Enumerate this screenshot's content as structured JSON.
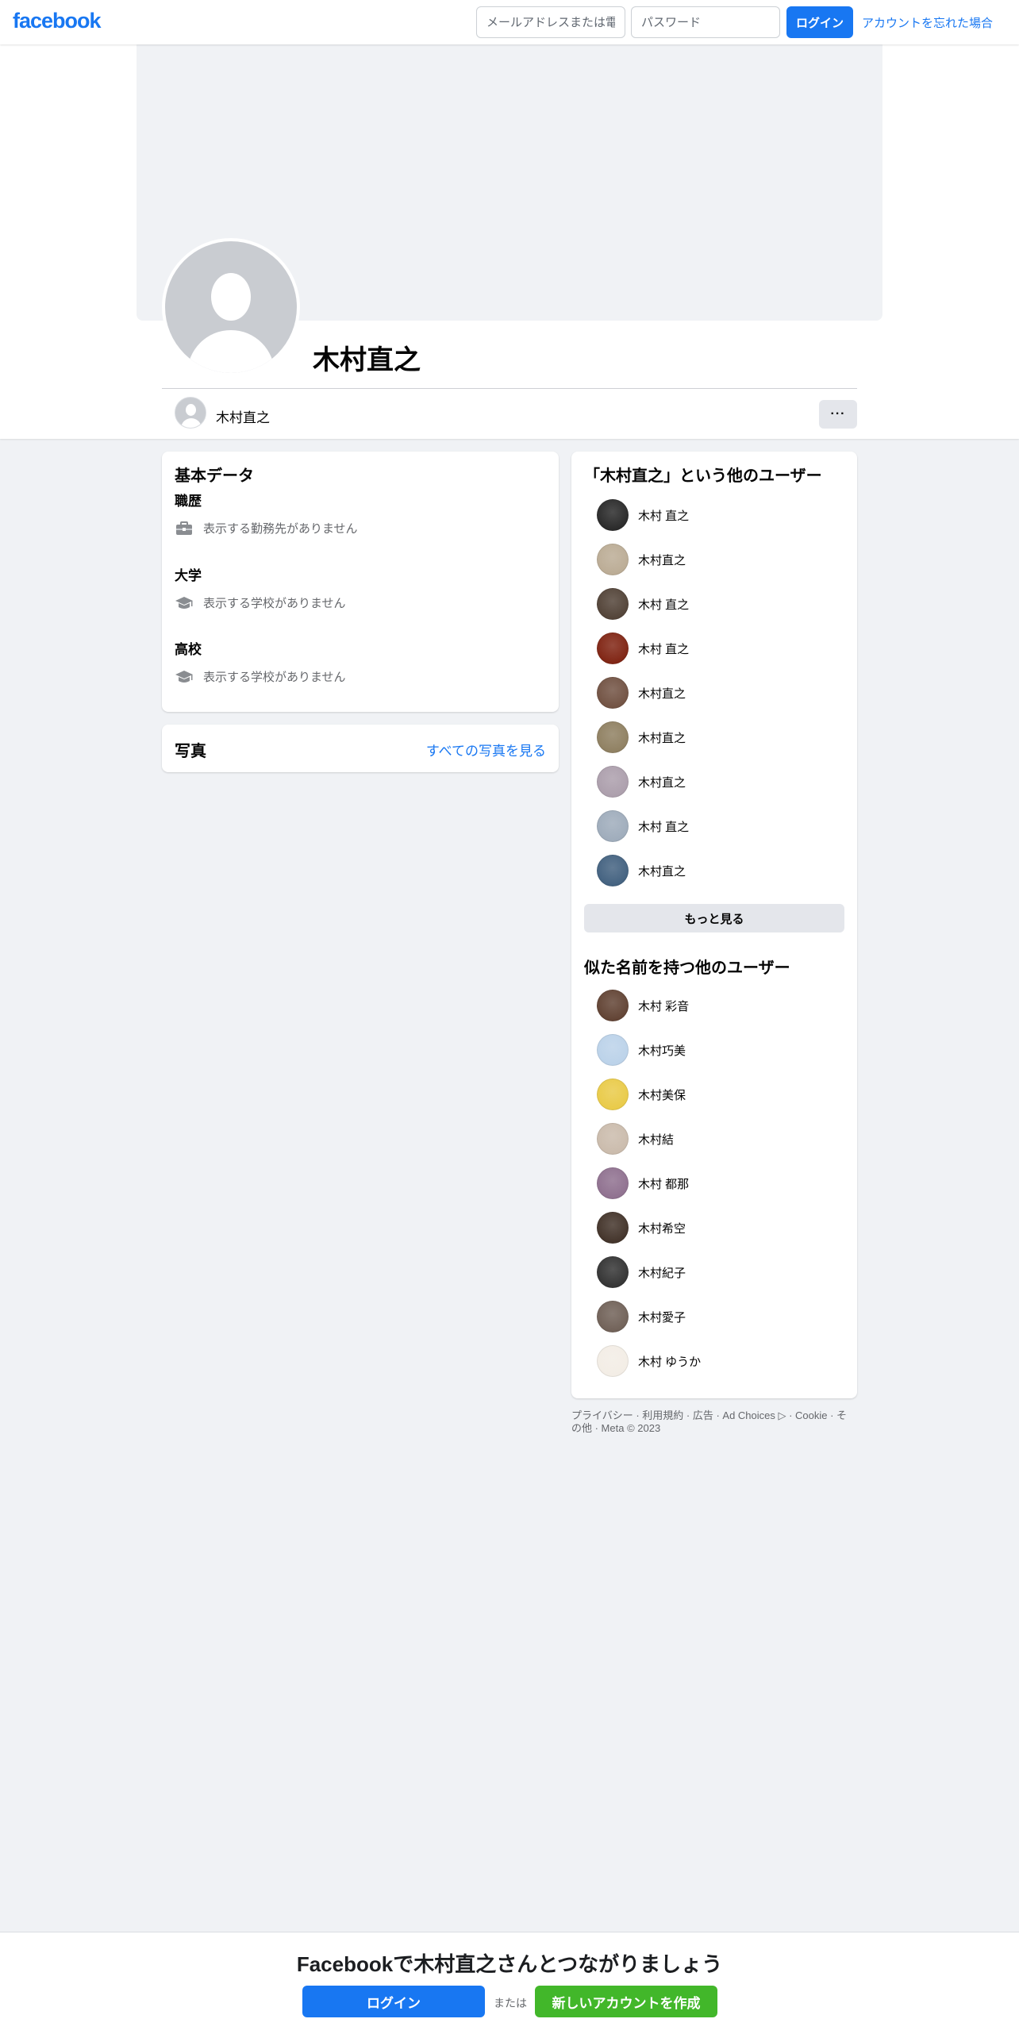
{
  "nav": {
    "logo": "facebook",
    "email_placeholder": "メールアドレスまたは電話番号",
    "password_placeholder": "パスワード",
    "login_label": "ログイン",
    "forgot_label": "アカウントを忘れた場合"
  },
  "profile": {
    "name": "木村直之",
    "mini_name": "木村直之",
    "more_label": "···"
  },
  "intro": {
    "title": "基本データ",
    "sections": [
      {
        "label": "職歴",
        "text": "表示する勤務先がありません",
        "icon": "briefcase-icon"
      },
      {
        "label": "大学",
        "text": "表示する学校がありません",
        "icon": "graduation-cap-icon"
      },
      {
        "label": "高校",
        "text": "表示する学校がありません",
        "icon": "graduation-cap-icon"
      }
    ]
  },
  "photos": {
    "title": "写真",
    "see_all": "すべての写真を見る"
  },
  "same_name": {
    "title": "「木村直之」という他のユーザー",
    "people": [
      {
        "name": "木村 直之",
        "color": "#1f1f1f"
      },
      {
        "name": "木村直之",
        "color": "#b8a890"
      },
      {
        "name": "木村 直之",
        "color": "#4a3a2e"
      },
      {
        "name": "木村 直之",
        "color": "#7a1a08"
      },
      {
        "name": "木村直之",
        "color": "#6b4a3a"
      },
      {
        "name": "木村直之",
        "color": "#8a7a5a"
      },
      {
        "name": "木村直之",
        "color": "#a89aa8"
      },
      {
        "name": "木村 直之",
        "color": "#9aa8b8"
      },
      {
        "name": "木村直之",
        "color": "#3a5a7a"
      }
    ],
    "see_more": "もっと見る"
  },
  "similar_names": {
    "title": "似た名前を持つ他のユーザー",
    "people": [
      {
        "name": "木村 彩音",
        "color": "#5a3a2a"
      },
      {
        "name": "木村巧美",
        "color": "#b8d0e8"
      },
      {
        "name": "木村美保",
        "color": "#e8c840"
      },
      {
        "name": "木村結",
        "color": "#c8b8a8"
      },
      {
        "name": "木村 都那",
        "color": "#8a6a8a"
      },
      {
        "name": "木村希空",
        "color": "#3a2a20"
      },
      {
        "name": "木村紀子",
        "color": "#2a2a2a"
      },
      {
        "name": "木村愛子",
        "color": "#6a5a50"
      },
      {
        "name": "木村 ゆうか",
        "color": "#f2ece4"
      }
    ]
  },
  "footer": {
    "text": "プライバシー · 利用規約 · 広告 · Ad Choices ▷ · Cookie · その他 · Meta © 2023"
  },
  "banner": {
    "title": "Facebookで木村直之さんとつながりましょう",
    "login_label": "ログイン",
    "or_label": "または",
    "create_label": "新しいアカウントを作成"
  },
  "colors": {
    "brand": "#1877f2",
    "create_green": "#42b72a",
    "background": "#f0f2f5"
  }
}
